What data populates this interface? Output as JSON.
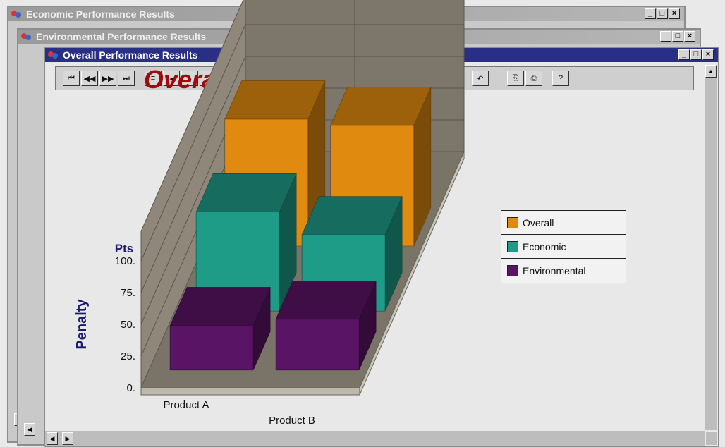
{
  "windows": {
    "economic": {
      "title": "Economic Performance Results"
    },
    "environmental": {
      "title": "Environmental Performance Results"
    },
    "overall": {
      "title": "Overall Performance Results"
    }
  },
  "window_controls": {
    "minimize": "_",
    "maximize": "□",
    "close": "×"
  },
  "toolbar": {
    "groups": [
      [
        "first-record",
        "previous-record",
        "next-record",
        "last-record"
      ],
      [
        "align-left",
        "step-back",
        "step-forward",
        "align-right"
      ],
      [
        "zoom-out",
        "zoom-in"
      ],
      [
        "chart-type-bar3d",
        "chart-type-line",
        "chart-type-area",
        "chart-type-stacked",
        "chart-type-column",
        "chart-type-pie",
        "chart-type-step",
        "chart-type-mixed"
      ],
      [
        "chart-3d-options",
        "chart-gallery"
      ],
      [
        "rotate-chart"
      ],
      [
        "copy",
        "print"
      ],
      [
        "help"
      ]
    ]
  },
  "colors": {
    "overall": "#e08a10",
    "economic": "#1f9c88",
    "environmental": "#5a1466",
    "title": "#a00a0a",
    "axis_label": "#1c1c6e"
  },
  "chart_data": {
    "type": "bar",
    "title": "Overall Performance",
    "ylabel": "Penalty",
    "yunit": "Pts",
    "categories": [
      "Product A",
      "Product B"
    ],
    "ylim": [
      0,
      100
    ],
    "yticks": [
      "0.",
      "25.",
      "50.",
      "75.",
      "100."
    ],
    "series": [
      {
        "name": "Overall",
        "values": [
          100,
          95
        ]
      },
      {
        "name": "Economic",
        "values": [
          78,
          60
        ]
      },
      {
        "name": "Environmental",
        "values": [
          35,
          40
        ]
      }
    ],
    "legend_position": "right",
    "grid": true,
    "three_d": true
  }
}
